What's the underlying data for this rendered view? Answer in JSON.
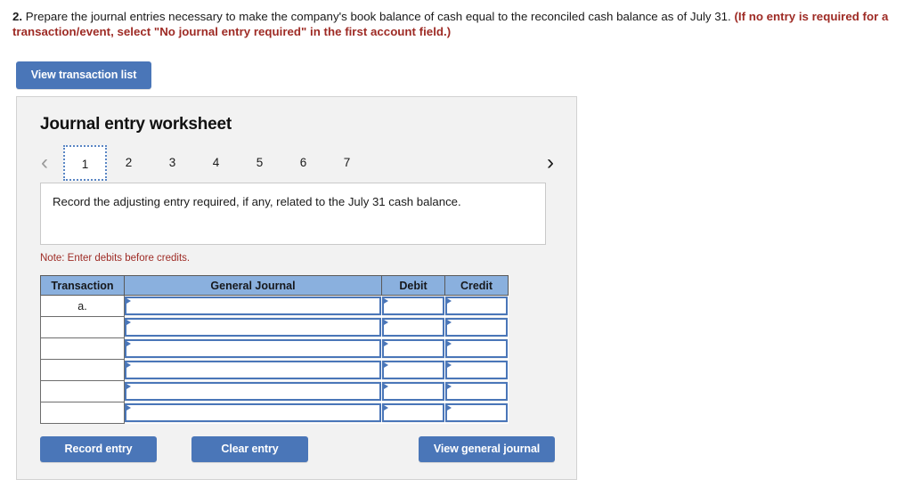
{
  "question": {
    "number": "2.",
    "text_main": " Prepare the journal entries necessary to make the company's book balance of cash equal to the reconciled cash balance as of July 31. ",
    "text_red": "(If no entry is required for a transaction/event, select \"No journal entry required\" in the first account field.)"
  },
  "toolbar": {
    "view_transaction_list_label": "View transaction list"
  },
  "card": {
    "title": "Journal entry worksheet",
    "prev_icon": "chevron-left-icon",
    "next_icon": "chevron-right-icon",
    "prev_glyph": "‹",
    "next_glyph": "›",
    "tabs": [
      {
        "label": "1",
        "active": true
      },
      {
        "label": "2",
        "active": false
      },
      {
        "label": "3",
        "active": false
      },
      {
        "label": "4",
        "active": false
      },
      {
        "label": "5",
        "active": false
      },
      {
        "label": "6",
        "active": false
      },
      {
        "label": "7",
        "active": false
      }
    ],
    "instruction": "Record the adjusting entry required, if any, related to the July 31 cash balance.",
    "note": "Note: Enter debits before credits."
  },
  "table": {
    "headers": [
      "Transaction",
      "General Journal",
      "Debit",
      "Credit"
    ],
    "rows": [
      {
        "transaction": "a.",
        "general_journal": "",
        "debit": "",
        "credit": ""
      },
      {
        "transaction": "",
        "general_journal": "",
        "debit": "",
        "credit": ""
      },
      {
        "transaction": "",
        "general_journal": "",
        "debit": "",
        "credit": ""
      },
      {
        "transaction": "",
        "general_journal": "",
        "debit": "",
        "credit": ""
      },
      {
        "transaction": "",
        "general_journal": "",
        "debit": "",
        "credit": ""
      },
      {
        "transaction": "",
        "general_journal": "",
        "debit": "",
        "credit": ""
      }
    ]
  },
  "footer": {
    "record_entry_label": "Record entry",
    "clear_entry_label": "Clear entry",
    "view_general_journal_label": "View general journal"
  },
  "colors": {
    "accent_blue": "#4a76b8",
    "header_blue": "#8ab0de",
    "alert_red": "#9e2b25",
    "card_bg": "#f2f2f2"
  }
}
